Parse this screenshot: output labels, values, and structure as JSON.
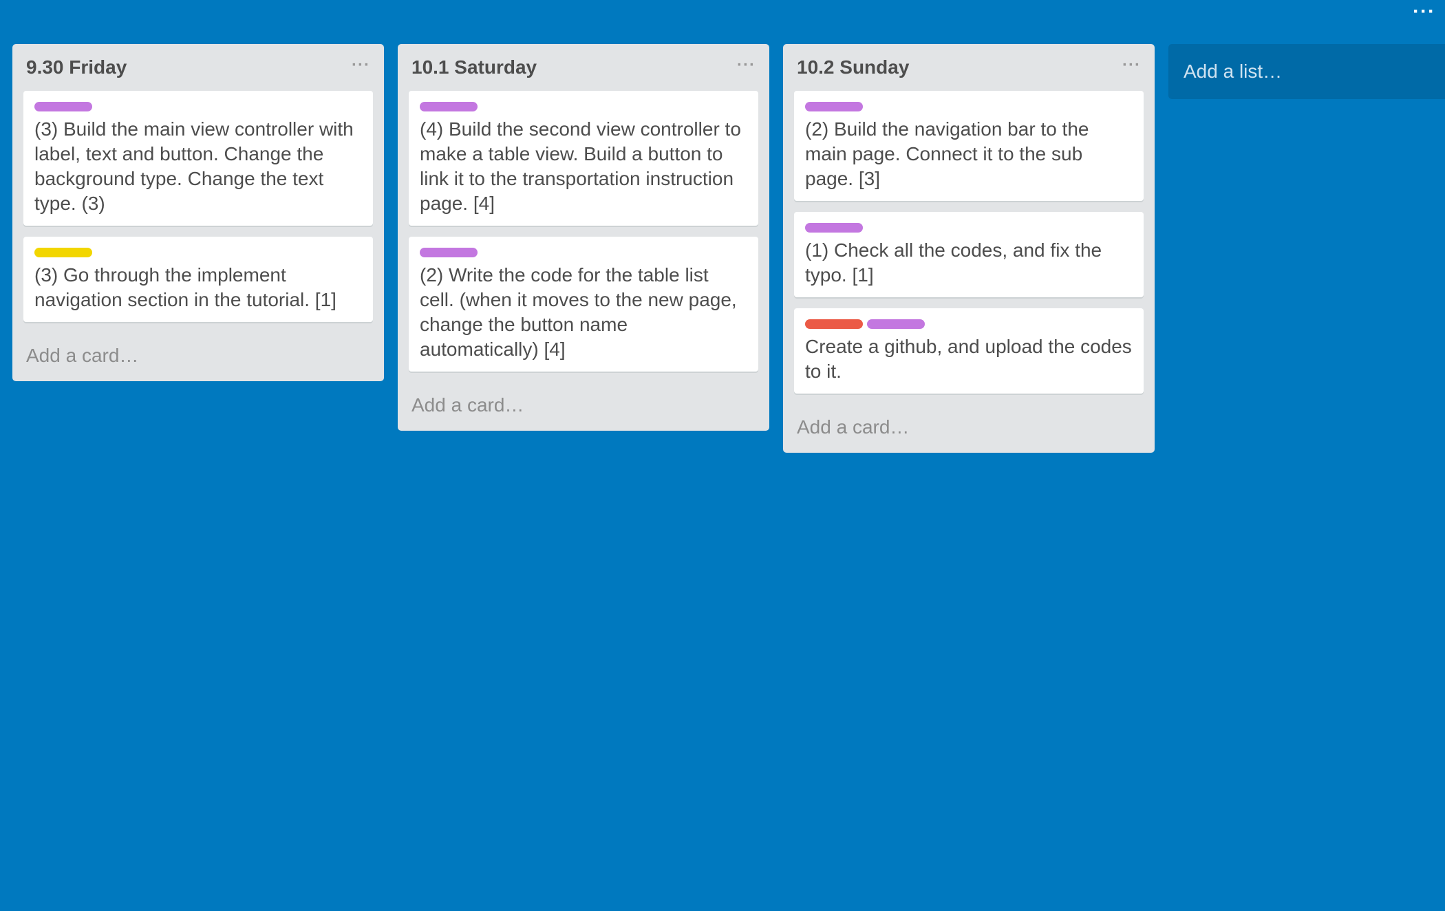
{
  "header": {
    "menu_label": "···"
  },
  "colors": {
    "board_background": "#0079bf",
    "list_background": "#e2e4e6",
    "label_purple": "#c377e0",
    "label_yellow": "#f2d600",
    "label_red": "#eb5a46"
  },
  "lists": [
    {
      "title": "9.30 Friday",
      "menu_label": "···",
      "add_card_label": "Add a card…",
      "cards": [
        {
          "labels": [
            "purple"
          ],
          "text": "(3) Build the main view controller with label, text and button. Change the background type. Change the text type. (3)"
        },
        {
          "labels": [
            "yellow"
          ],
          "text": "(3) Go through the implement navigation section in the tutorial. [1]"
        }
      ]
    },
    {
      "title": "10.1 Saturday",
      "menu_label": "···",
      "add_card_label": "Add a card…",
      "cards": [
        {
          "labels": [
            "purple"
          ],
          "text": "(4) Build the second view controller to make a table view. Build a button to link it to the transportation instruction page. [4]"
        },
        {
          "labels": [
            "purple"
          ],
          "text": "(2) Write the code for the table list cell. (when it moves to the new page, change the button name automatically) [4]"
        }
      ]
    },
    {
      "title": "10.2 Sunday",
      "menu_label": "···",
      "add_card_label": "Add a card…",
      "cards": [
        {
          "labels": [
            "purple"
          ],
          "text": "(2) Build the navigation bar to the main page. Connect it to the sub page. [3]"
        },
        {
          "labels": [
            "purple"
          ],
          "text": "(1) Check all the codes, and fix the typo. [1]"
        },
        {
          "labels": [
            "red",
            "purple"
          ],
          "text": "Create a github, and upload the codes to it."
        }
      ]
    }
  ],
  "add_list_label": "Add a list…"
}
